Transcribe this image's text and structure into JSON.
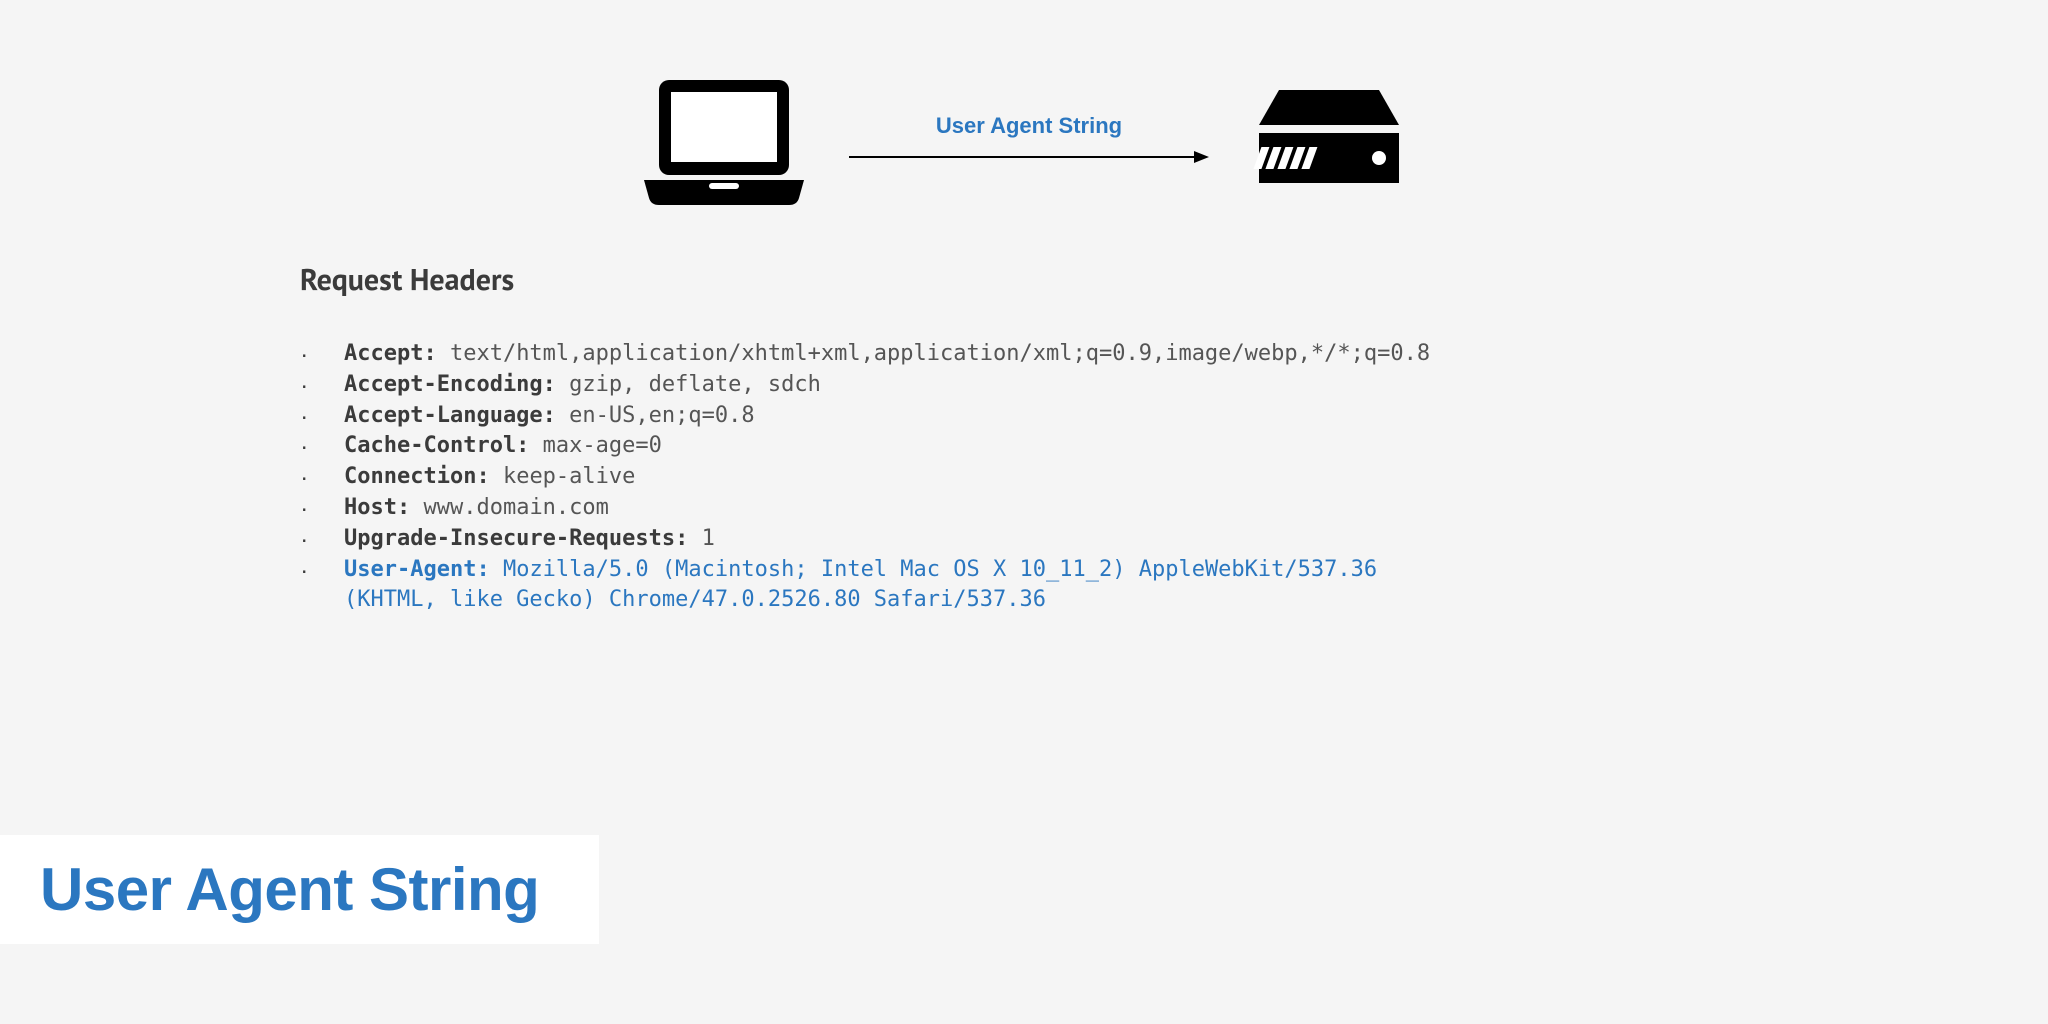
{
  "diagram": {
    "arrow_label": "User Agent String"
  },
  "section_title": "Request Headers",
  "headers": [
    {
      "key": "Accept:",
      "value": "text/html,application/xhtml+xml,application/xml;q=0.9,image/webp,*/*;q=0.8",
      "highlight": false
    },
    {
      "key": "Accept-Encoding:",
      "value": "gzip, deflate, sdch",
      "highlight": false
    },
    {
      "key": "Accept-Language:",
      "value": "en-US,en;q=0.8",
      "highlight": false
    },
    {
      "key": "Cache-Control:",
      "value": "max-age=0",
      "highlight": false
    },
    {
      "key": "Connection:",
      "value": "keep-alive",
      "highlight": false
    },
    {
      "key": "Host:",
      "value": "www.domain.com",
      "highlight": false
    },
    {
      "key": "Upgrade-Insecure-Requests:",
      "value": "1",
      "highlight": false
    },
    {
      "key": "User-Agent:",
      "value": "Mozilla/5.0 (Macintosh; Intel Mac OS X 10_11_2) AppleWebKit/537.36 (KHTML, like Gecko) Chrome/47.0.2526.80 Safari/537.36",
      "highlight": true
    }
  ],
  "title_card": "User Agent String"
}
